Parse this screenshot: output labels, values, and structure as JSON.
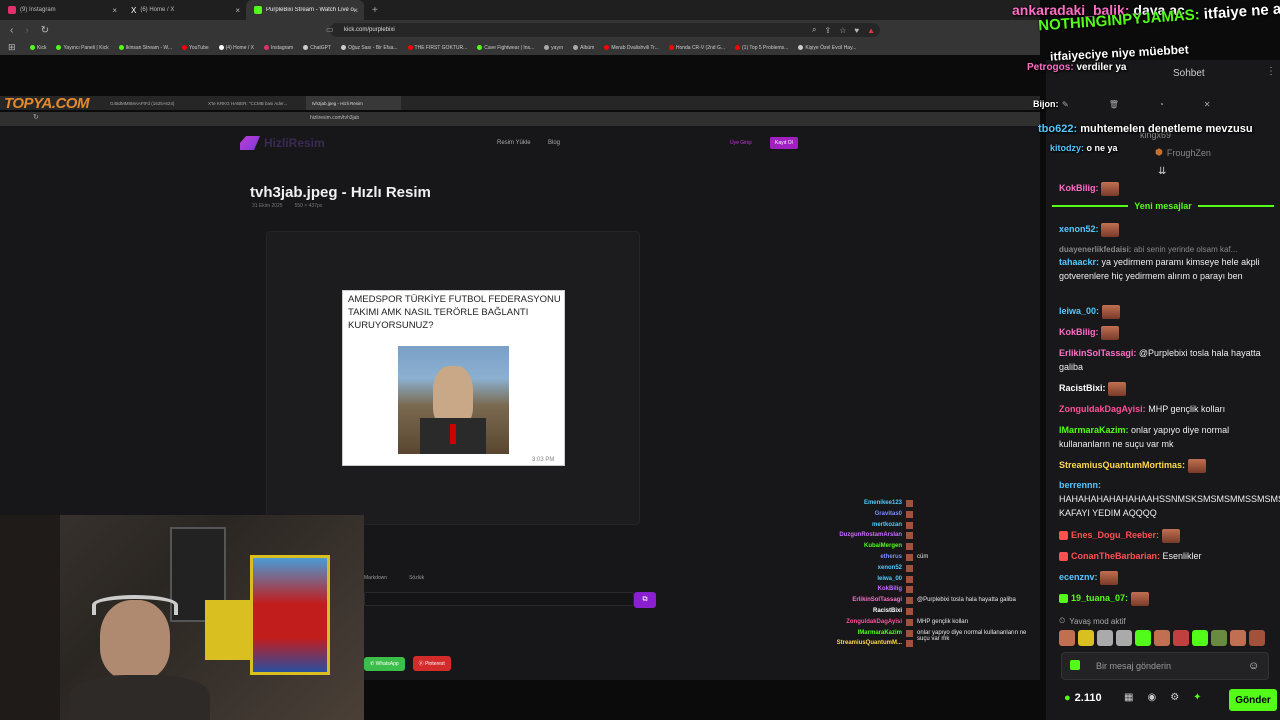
{
  "browser": {
    "tabs": [
      {
        "label": "(9) Instagram",
        "color": "#e1306c"
      },
      {
        "label": "(6) Home / X",
        "color": "#ffffff"
      },
      {
        "label": "PurpleBixi Stream - Watch Live o...",
        "color": "#53fc18"
      }
    ],
    "url": "kick.com/purplebixi",
    "bookmarks": [
      {
        "label": "Kick",
        "color": "#53fc18"
      },
      {
        "label": "Yayıncı Paneli | Kick",
        "color": "#53fc18"
      },
      {
        "label": "Ikinsan Stream - W...",
        "color": "#53fc18"
      },
      {
        "label": "YouTube",
        "color": "#ff0000"
      },
      {
        "label": "(4) Home / X",
        "color": "#ffffff"
      },
      {
        "label": "Instagram",
        "color": "#e1306c"
      },
      {
        "label": "ChatGPT",
        "color": "#cccccc"
      },
      {
        "label": "Oğuz Sası - Bir Efsa...",
        "color": "#cccccc"
      },
      {
        "label": "THE FIRST GOKTUR...",
        "color": "#ff0000"
      },
      {
        "label": "Cave Fightwear | Ins...",
        "color": "#53fc18"
      },
      {
        "label": "yayın",
        "color": "#aaaaaa"
      },
      {
        "label": "Albüm",
        "color": "#aaaaaa"
      },
      {
        "label": "Merab Dvalishvili Tr...",
        "color": "#ff0000"
      },
      {
        "label": "Honda CR-V (2nd G...",
        "color": "#ff0000"
      },
      {
        "label": "(1) Top 5 Problems...",
        "color": "#ff0000"
      },
      {
        "label": "Kişiye Özel Evcil Hay...",
        "color": "#cccccc"
      }
    ]
  },
  "inner": {
    "logo": "TOPYA.COM",
    "tabs": [
      {
        "label": "G48dMM8MAAFtFd (1625×624)"
      },
      {
        "label": "X'te KRKG HABER: \"CCMB basi Ader..."
      },
      {
        "label": "tvh3jab.jpeg - Hizli Resim"
      }
    ],
    "url": "hizliresim.com/tvh3jab",
    "site_logo": "HizliResim",
    "nav": [
      "Resim Yükle",
      "Blog"
    ],
    "login": "Üye Girişi",
    "register": "Kayıt Ol",
    "title": "tvh3jab.jpeg - Hızlı Resim",
    "meta_date": "31 Ekim 2025",
    "meta_size": "550 × 437px",
    "meme_text": "AMEDSPOR TÜRKİYE FUTBOL FEDERASYONU TAKIMI AMK NASIL TERÖRLE BAĞLANTI KURUYORSUNUZ?",
    "meme_time": "3:03 PM",
    "tab_markdown": "Markdown",
    "tab_sozluk": "Sözlük",
    "share": [
      "WhatsApp",
      "Pinterest"
    ]
  },
  "scene_chat": [
    {
      "name": "Emenikee123",
      "color": "#53c8ff",
      "msg": ""
    },
    {
      "name": "Gravitas0",
      "color": "#7a8cff",
      "msg": ""
    },
    {
      "name": "mertkozan",
      "color": "#53c8ff",
      "msg": ""
    },
    {
      "name": "DuzgunRostamArslan",
      "color": "#c86cff",
      "msg": ""
    },
    {
      "name": "KubaiMergen",
      "color": "#53fc18",
      "msg": ""
    },
    {
      "name": "etherus",
      "color": "#7a8cff",
      "msg": "cüm"
    },
    {
      "name": "xenon52",
      "color": "#53c8ff",
      "msg": ""
    },
    {
      "name": "leiwa_00",
      "color": "#53c8ff",
      "msg": ""
    },
    {
      "name": "KokBilig",
      "color": "#c86cff",
      "msg": ""
    },
    {
      "name": "ErlikinSolTassagi",
      "color": "#ff6ec7",
      "msg": "@Purplebixi tosla hala hayatta galiba"
    },
    {
      "name": "RacistBixi",
      "color": "#ffffff",
      "msg": ""
    },
    {
      "name": "ZonguldakDagAyisi",
      "color": "#ff4f9a",
      "msg": "MHP gençlik kolları"
    },
    {
      "name": "lMarmaraKazim",
      "color": "#53fc18",
      "msg": "onlar yapıyo diye normal kullananların ne suçu var mk"
    },
    {
      "name": "StreamiusQuantumM...",
      "color": "#ffd84a",
      "msg": ""
    }
  ],
  "float_chat": [
    {
      "name": "ankaradaki_balik:",
      "msg": "dava aç"
    },
    {
      "name": "NOTHINGINPYJAMAS:",
      "msg": "itfaiye ne alaka"
    },
    {
      "name": "",
      "msg": "itfaiyeciye niye müebbet"
    },
    {
      "name": "Petrogos:",
      "msg": "verdiler ya"
    },
    {
      "name": "Bijon:",
      "msg": ""
    },
    {
      "name": "tbo622:",
      "msg": "muhtemelen denetleme mevzusu"
    },
    {
      "name": "kitodzy:",
      "msg": "o ne ya"
    }
  ],
  "chat": {
    "header": "Sohbet",
    "user1": "kingx69",
    "user2": "FroughZen",
    "new_messages": "Yeni mesajlar",
    "messages": [
      {
        "name": "KokBilig:",
        "color": "#ff6ec7",
        "text": ""
      },
      {
        "name": "xenon52:",
        "color": "#53c8ff",
        "text": ""
      },
      {
        "name": "duayenerlikfedaisi:",
        "color": "#888888",
        "text": "abi senin yerinde olsam kaf..."
      },
      {
        "name": "tahaackr:",
        "color": "#53c8ff",
        "text": "ya yedirmem paramı kimseye hele akpli gotverenlere hiç yedirmem alırım o parayı ben"
      },
      {
        "name": "leiwa_00:",
        "color": "#53c8ff",
        "text": ""
      },
      {
        "name": "KokBilig:",
        "color": "#ff6ec7",
        "text": ""
      },
      {
        "name": "ErlikinSolTassagi:",
        "color": "#ff6ec7",
        "text": "@Purplebixi tosla hala hayatta galiba"
      },
      {
        "name": "RacistBixi:",
        "color": "#ffffff",
        "text": ""
      },
      {
        "name": "ZonguldakDagAyisi:",
        "color": "#ff4f9a",
        "text": "MHP gençlik kolları"
      },
      {
        "name": "lMarmaraKazim:",
        "color": "#53fc18",
        "text": "onlar yapıyo diye normal kullananların ne suçu var mk"
      },
      {
        "name": "StreamiusQuantumMortimas:",
        "color": "#ffd84a",
        "text": ""
      },
      {
        "name": "berrennn:",
        "color": "#53c8ff",
        "text": "HAHAHAHAHAHAHAAHSSNMSKSMSMSMMSSMSMSMSMS KAFAYI YEDIM AQQQQ"
      },
      {
        "name": "Enes_Dogu_Reeber:",
        "color": "#ff4f4f",
        "text": ""
      },
      {
        "name": "ConanTheBarbarian:",
        "color": "#ff4f4f",
        "text": "Esenlikler"
      },
      {
        "name": "ecenznv:",
        "color": "#53c8ff",
        "text": ""
      },
      {
        "name": "19_tuana_07:",
        "color": "#53fc18",
        "text": ""
      }
    ],
    "slow_mode": "Yavaş mod aktif",
    "input_placeholder": "Bir mesaj gönderin",
    "viewers": "2.110",
    "send": "Gönder"
  }
}
